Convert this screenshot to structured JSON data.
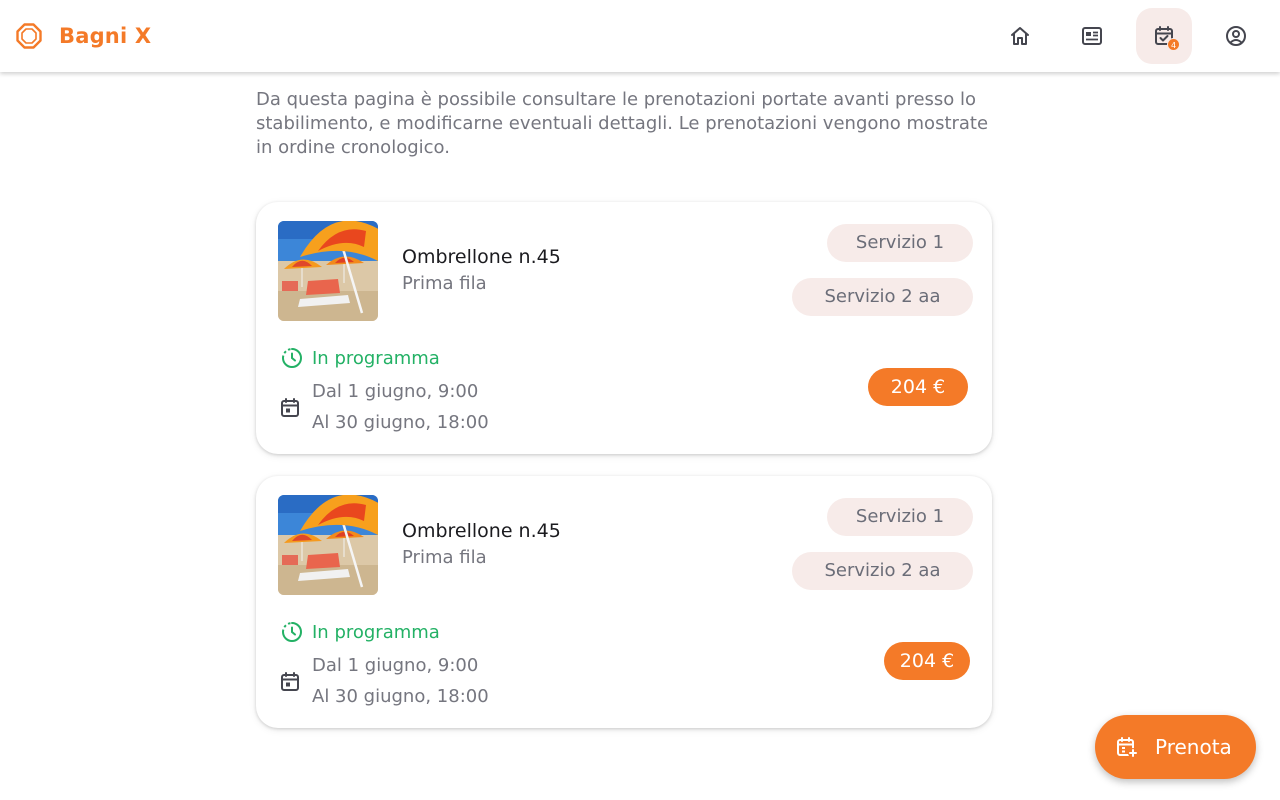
{
  "app": {
    "name": "Bagni X",
    "logo_icon": "octagon-logo-icon",
    "accent_color": "#f47a28"
  },
  "nav": {
    "items": [
      {
        "id": "home",
        "icon": "home-icon",
        "active": false
      },
      {
        "id": "news",
        "icon": "newspaper-icon",
        "active": false
      },
      {
        "id": "bookings",
        "icon": "calendar-check-icon",
        "active": true,
        "badge": "4"
      },
      {
        "id": "account",
        "icon": "account-circle-icon",
        "active": false
      }
    ]
  },
  "intro": {
    "text": "Da questa pagina è possibile consultare le prenotazioni portate avanti presso lo stabilimento, e modificarne eventuali dettagli. Le prenotazioni vengono mostrate in ordine cronologico."
  },
  "bookings": [
    {
      "title": "Ombrellone n.45",
      "subtitle": "Prima fila",
      "services": [
        "Servizio 1",
        "Servizio 2 aa"
      ],
      "status": "In programma",
      "status_color": "#23b165",
      "date_from": "Dal 1 giugno, 9:00",
      "date_to": "Al 30 giugno, 18:00",
      "price": "204 €"
    },
    {
      "title": "Ombrellone n.45",
      "subtitle": "Prima fila",
      "services": [
        "Servizio 1",
        "Servizio 2 aa"
      ],
      "status": "In programma",
      "status_color": "#23b165",
      "date_from": "Dal 1 giugno, 9:00",
      "date_to": "Al 30 giugno, 18:00",
      "price": "204 €"
    }
  ],
  "fab": {
    "label": "Prenota",
    "icon": "calendar-add-icon"
  }
}
